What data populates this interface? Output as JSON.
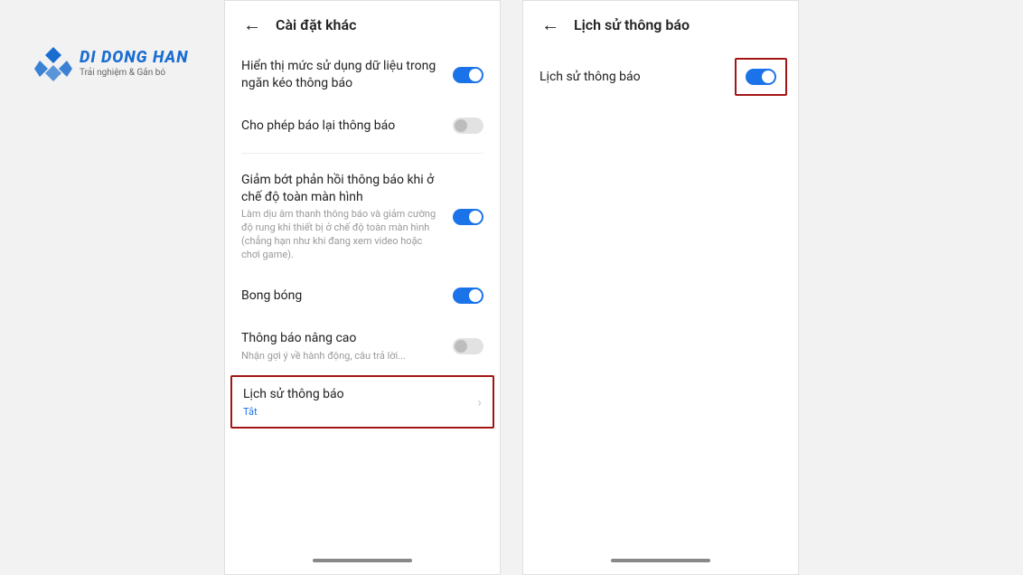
{
  "logo": {
    "main": "DI DONG HAN",
    "sub": "Trải nghiệm & Gắn bó"
  },
  "screen1": {
    "title": "Cài đặt khác",
    "items": {
      "data_usage": {
        "title": "Hiển thị mức sử dụng dữ liệu trong ngăn kéo thông báo",
        "on": true
      },
      "snooze": {
        "title": "Cho phép báo lại thông báo",
        "on": false
      },
      "fullscreen": {
        "title": "Giảm bớt phản hồi thông báo khi ở chế độ toàn màn hình",
        "desc": "Làm dịu âm thanh thông báo và giảm cường độ rung khi thiết bị ở chế độ toàn màn hình (chẳng hạn như khi đang xem video hoặc chơi game).",
        "on": true
      },
      "bubbles": {
        "title": "Bong bóng",
        "on": true
      },
      "advanced": {
        "title": "Thông báo nâng cao",
        "desc": "Nhận gợi ý về hành động, câu trả lời...",
        "on": false
      },
      "history": {
        "title": "Lịch sử thông báo",
        "sub": "Tắt"
      }
    }
  },
  "screen2": {
    "title": "Lịch sử thông báo",
    "history": {
      "title": "Lịch sử thông báo",
      "on": true
    }
  }
}
